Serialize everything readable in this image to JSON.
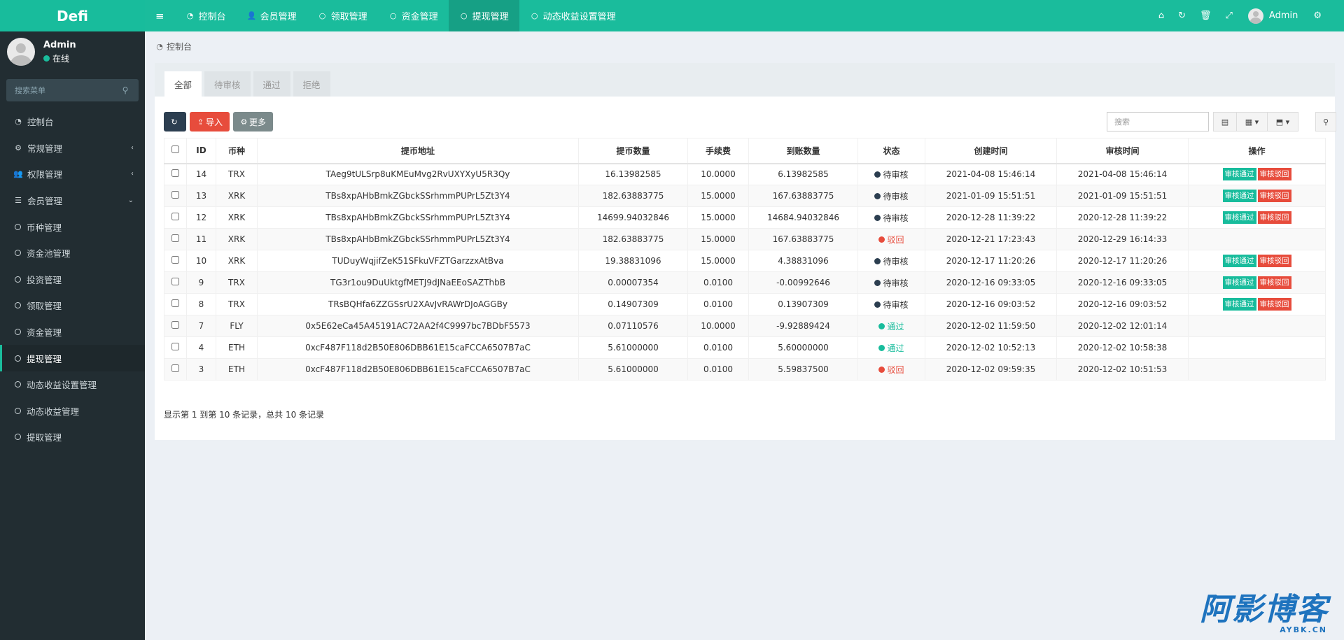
{
  "app": {
    "logo": "Defi"
  },
  "topnav": {
    "toggle_icon": "bars-icon",
    "items": [
      {
        "label": "控制台",
        "icon": "dashboard-icon",
        "active": false
      },
      {
        "label": "会员管理",
        "icon": "user-icon",
        "active": false
      },
      {
        "label": "领取管理",
        "icon": "circle-icon",
        "active": false
      },
      {
        "label": "资金管理",
        "icon": "circle-icon",
        "active": false
      },
      {
        "label": "提现管理",
        "icon": "circle-icon",
        "active": true
      },
      {
        "label": "动态收益设置管理",
        "icon": "circle-icon",
        "active": false
      }
    ],
    "right_icons": [
      "home-icon",
      "refresh-icon",
      "trash-icon",
      "fullscreen-icon"
    ],
    "user_name": "Admin",
    "settings_icon": "cogs-icon"
  },
  "sidebar": {
    "user": {
      "name": "Admin",
      "status": "在线"
    },
    "search_placeholder": "搜索菜单",
    "menu": [
      {
        "label": "控制台",
        "icon": "dashboard-icon",
        "type": "top",
        "caret": ""
      },
      {
        "label": "常规管理",
        "icon": "cogs-icon",
        "type": "top",
        "caret": "‹"
      },
      {
        "label": "权限管理",
        "icon": "group-icon",
        "type": "top",
        "caret": "‹"
      },
      {
        "label": "会员管理",
        "icon": "list-icon",
        "type": "top",
        "caret": "⌄"
      },
      {
        "label": "币种管理",
        "type": "sub"
      },
      {
        "label": "资金池管理",
        "type": "sub"
      },
      {
        "label": "投资管理",
        "type": "sub"
      },
      {
        "label": "领取管理",
        "type": "sub"
      },
      {
        "label": "资金管理",
        "type": "sub"
      },
      {
        "label": "提现管理",
        "type": "sub",
        "active": true
      },
      {
        "label": "动态收益设置管理",
        "type": "sub"
      },
      {
        "label": "动态收益管理",
        "type": "sub"
      },
      {
        "label": "提取管理",
        "type": "sub"
      }
    ]
  },
  "breadcrumb": {
    "label": "控制台"
  },
  "tabs": [
    {
      "label": "全部",
      "active": true
    },
    {
      "label": "待审核",
      "active": false
    },
    {
      "label": "通过",
      "active": false
    },
    {
      "label": "拒绝",
      "active": false
    }
  ],
  "toolbar": {
    "import_label": "导入",
    "more_label": "更多",
    "search_placeholder": "搜索"
  },
  "table": {
    "headers": [
      "ID",
      "币种",
      "提币地址",
      "提币数量",
      "手续费",
      "到账数量",
      "状态",
      "创建时间",
      "审核时间",
      "操作"
    ],
    "approve_label": "审核通过",
    "reject_label": "审核驳回",
    "rows": [
      {
        "id": "14",
        "coin": "TRX",
        "address": "TAeg9tULSrp8uKMEuMvg2RvUXYXyU5R3Qy",
        "amount": "16.13982585",
        "fee": "10.0000",
        "received": "6.13982585",
        "status": "待审核",
        "status_type": "pending",
        "created": "2021-04-08 15:46:14",
        "reviewed": "2021-04-08 15:46:14",
        "actions": true
      },
      {
        "id": "13",
        "coin": "XRK",
        "address": "TBs8xpAHbBmkZGbckSSrhmmPUPrL5Zt3Y4",
        "amount": "182.63883775",
        "fee": "15.0000",
        "received": "167.63883775",
        "status": "待审核",
        "status_type": "pending",
        "created": "2021-01-09 15:51:51",
        "reviewed": "2021-01-09 15:51:51",
        "actions": true
      },
      {
        "id": "12",
        "coin": "XRK",
        "address": "TBs8xpAHbBmkZGbckSSrhmmPUPrL5Zt3Y4",
        "amount": "14699.94032846",
        "fee": "15.0000",
        "received": "14684.94032846",
        "status": "待审核",
        "status_type": "pending",
        "created": "2020-12-28 11:39:22",
        "reviewed": "2020-12-28 11:39:22",
        "actions": true
      },
      {
        "id": "11",
        "coin": "XRK",
        "address": "TBs8xpAHbBmkZGbckSSrhmmPUPrL5Zt3Y4",
        "amount": "182.63883775",
        "fee": "15.0000",
        "received": "167.63883775",
        "status": "驳回",
        "status_type": "reject",
        "created": "2020-12-21 17:23:43",
        "reviewed": "2020-12-29 16:14:33",
        "actions": false
      },
      {
        "id": "10",
        "coin": "XRK",
        "address": "TUDuyWqjifZeK51SFkuVFZTGarzzxAtBva",
        "amount": "19.38831096",
        "fee": "15.0000",
        "received": "4.38831096",
        "status": "待审核",
        "status_type": "pending",
        "created": "2020-12-17 11:20:26",
        "reviewed": "2020-12-17 11:20:26",
        "actions": true
      },
      {
        "id": "9",
        "coin": "TRX",
        "address": "TG3r1ou9DuUktgfMETJ9dJNaEEoSAZThbB",
        "amount": "0.00007354",
        "fee": "0.0100",
        "received": "-0.00992646",
        "status": "待审核",
        "status_type": "pending",
        "created": "2020-12-16 09:33:05",
        "reviewed": "2020-12-16 09:33:05",
        "actions": true
      },
      {
        "id": "8",
        "coin": "TRX",
        "address": "TRsBQHfa6ZZGSsrU2XAvJvRAWrDJoAGGBy",
        "amount": "0.14907309",
        "fee": "0.0100",
        "received": "0.13907309",
        "status": "待审核",
        "status_type": "pending",
        "created": "2020-12-16 09:03:52",
        "reviewed": "2020-12-16 09:03:52",
        "actions": true
      },
      {
        "id": "7",
        "coin": "FLY",
        "address": "0x5E62eCa45A45191AC72AA2f4C9997bc7BDbF5573",
        "amount": "0.07110576",
        "fee": "10.0000",
        "received": "-9.92889424",
        "status": "通过",
        "status_type": "pass",
        "created": "2020-12-02 11:59:50",
        "reviewed": "2020-12-02 12:01:14",
        "actions": false
      },
      {
        "id": "4",
        "coin": "ETH",
        "address": "0xcF487F118d2B50E806DBB61E15caFCCA6507B7aC",
        "amount": "5.61000000",
        "fee": "0.0100",
        "received": "5.60000000",
        "status": "通过",
        "status_type": "pass",
        "created": "2020-12-02 10:52:13",
        "reviewed": "2020-12-02 10:58:38",
        "actions": false
      },
      {
        "id": "3",
        "coin": "ETH",
        "address": "0xcF487F118d2B50E806DBB61E15caFCCA6507B7aC",
        "amount": "5.61000000",
        "fee": "0.0100",
        "received": "5.59837500",
        "status": "驳回",
        "status_type": "reject",
        "created": "2020-12-02 09:59:35",
        "reviewed": "2020-12-02 10:51:53",
        "actions": false
      }
    ]
  },
  "pagination": {
    "summary": "显示第 1 到第 10 条记录，总共 10 条记录"
  },
  "watermark": {
    "big": "阿影博客",
    "small": "AYBK.CN"
  }
}
